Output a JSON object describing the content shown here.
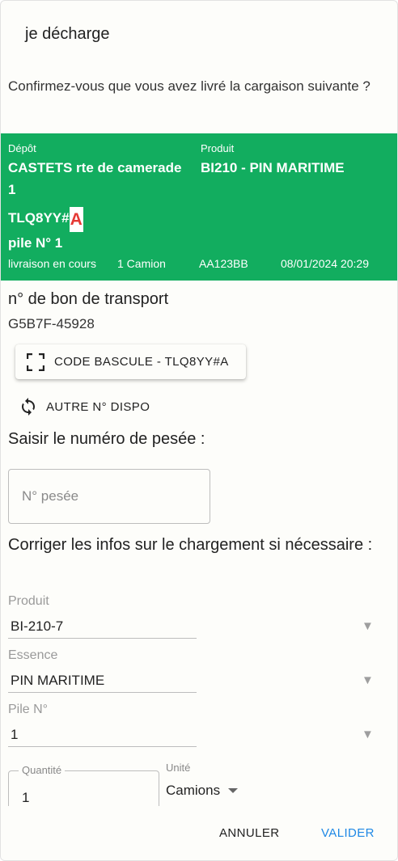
{
  "dialog": {
    "title": "je décharge",
    "confirm_text": "Confirmez-vous que vous avez livré la cargaison suivante ?"
  },
  "banner": {
    "depot_label": "Dépôt",
    "depot_value_line1": "CASTETS rte de camerade",
    "depot_value_line2": "1",
    "produit_label": "Produit",
    "produit_value": "BI210 - PIN MARITIME",
    "code_prefix": "TLQ8YY#",
    "code_letter": "A",
    "pile": "pile N° 1",
    "status": "livraison en cours",
    "camion": "1 Camion",
    "plate": "AA123BB",
    "datetime": "08/01/2024 20:29",
    "bg_color": "#12ad5f"
  },
  "transport": {
    "heading": "n° de bon de transport",
    "value": "G5B7F-45928",
    "scan_button": "CODE BASCULE - TLQ8YY#A",
    "scan_icon": "scan-frame-icon",
    "dispo_button": "AUTRE N° DISPO",
    "dispo_icon": "refresh-icon"
  },
  "pesee": {
    "heading": "Saisir le numéro de pesée :",
    "placeholder": "N° pesée"
  },
  "correction": {
    "heading": "Corriger les infos sur le chargement si nécessaire :",
    "produit_label": "Produit",
    "produit_value": "BI-210-7",
    "essence_label": "Essence",
    "essence_value": "PIN MARITIME",
    "pile_label": "Pile N°",
    "pile_value": "1",
    "arrow_glyph": "▼",
    "quantite_label": "Quantité",
    "quantite_value": "1",
    "unite_label": "Unité",
    "unite_value": "Camions"
  },
  "actions": {
    "cancel": "ANNULER",
    "confirm": "VALIDER",
    "confirm_color": "#1e88e5"
  }
}
